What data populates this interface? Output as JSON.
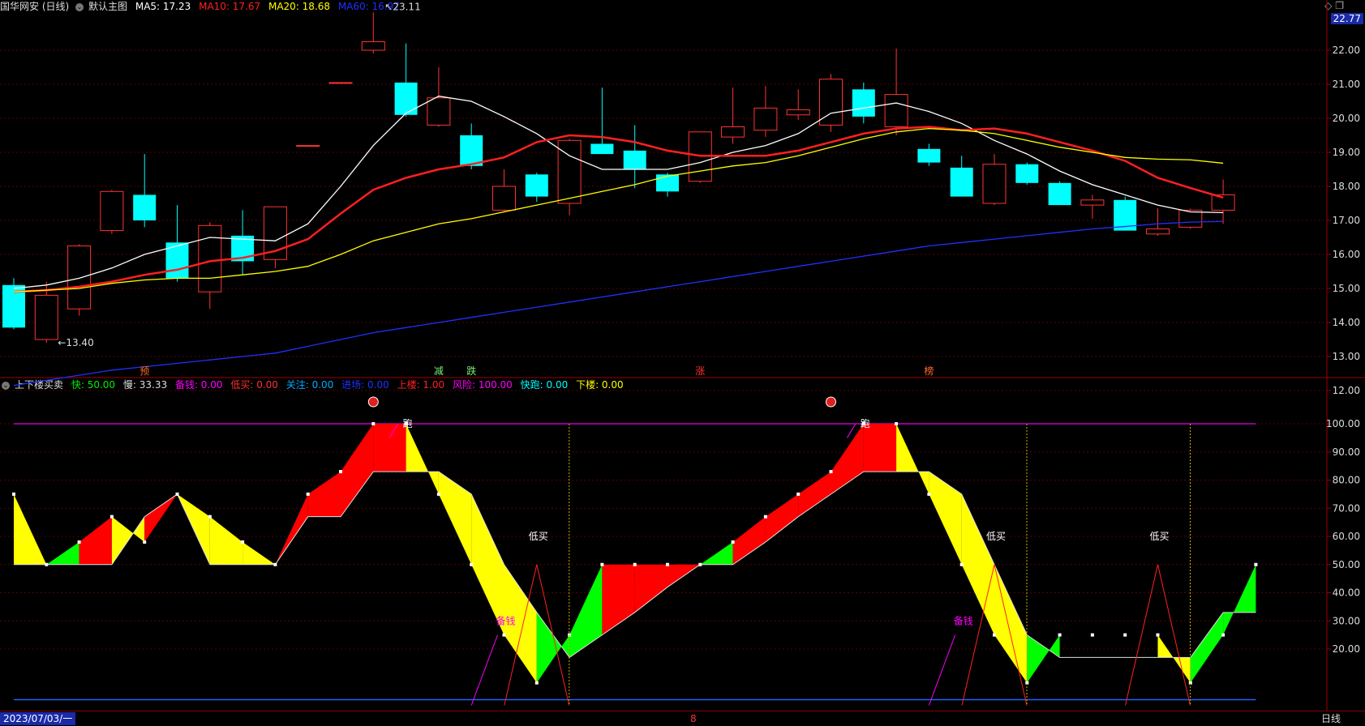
{
  "main": {
    "title": "国华网安 (日线)",
    "template": "默认主图",
    "ma": [
      {
        "label": "MA5: 17.23",
        "color": "#ffffff"
      },
      {
        "label": "MA10: 17.67",
        "color": "#ff2020"
      },
      {
        "label": "MA20: 18.68",
        "color": "#ffff00"
      },
      {
        "label": "MA60: 16.97",
        "color": "#2030ff"
      }
    ],
    "corner_value": "22.77",
    "high_label": "23.11",
    "low_label": "13.40",
    "signals": [
      {
        "text": "预",
        "index": 4,
        "color": "#ff6a2a"
      },
      {
        "text": "减",
        "index": 13,
        "color": "#77ee77"
      },
      {
        "text": "跌",
        "index": 14,
        "color": "#77ee77"
      },
      {
        "text": "涨",
        "index": 21,
        "color": "#ff3030"
      },
      {
        "text": "榜",
        "index": 28,
        "color": "#ff6a2a"
      }
    ]
  },
  "sub": {
    "title": "上下楼买卖",
    "items": [
      {
        "label": "快: 50.00",
        "color": "#00ee00"
      },
      {
        "label": "慢: 33.33",
        "color": "#dddddd"
      },
      {
        "label": "备钱: 0.00",
        "color": "#ff00ff"
      },
      {
        "label": "低买: 0.00",
        "color": "#ff3030"
      },
      {
        "label": "关注: 0.00",
        "color": "#00aaff"
      },
      {
        "label": "进场: 0.00",
        "color": "#2030ff"
      },
      {
        "label": "上楼: 1.00",
        "color": "#ff2020"
      },
      {
        "label": "风险: 100.00",
        "color": "#ff00ff"
      },
      {
        "label": "快跑: 0.00",
        "color": "#00ffff"
      },
      {
        "label": "下楼: 0.00",
        "color": "#ffff00"
      }
    ],
    "text_labels": [
      {
        "text": "跑",
        "index": 12,
        "value": 100,
        "color": "#ffffff"
      },
      {
        "text": "跑",
        "index": 26,
        "value": 100,
        "color": "#ffffff"
      },
      {
        "text": "低买",
        "index": 16,
        "value": 60,
        "color": "#ffffff"
      },
      {
        "text": "低买",
        "index": 30,
        "value": 60,
        "color": "#ffffff"
      },
      {
        "text": "低买",
        "index": 35,
        "value": 60,
        "color": "#ffffff"
      },
      {
        "text": "备钱",
        "index": 15,
        "value": 30,
        "color": "#ff00ff"
      },
      {
        "text": "备钱",
        "index": 29,
        "value": 30,
        "color": "#ff00ff"
      }
    ]
  },
  "bottom": {
    "date": "2023/07/03/一",
    "period": "日线",
    "marker": "8"
  },
  "chart_data": [
    {
      "type": "candlestick",
      "title": "国华网安 (日线)",
      "ylim": [
        11.8,
        23.3
      ],
      "yticks": [
        "12.00",
        "13.00",
        "14.00",
        "15.00",
        "16.00",
        "17.00",
        "18.00",
        "19.00",
        "20.00",
        "21.00",
        "22.00"
      ],
      "candles": [
        {
          "o": 15.1,
          "h": 15.3,
          "l": 13.8,
          "c": 13.85
        },
        {
          "o": 13.5,
          "h": 15.2,
          "l": 13.4,
          "c": 14.8
        },
        {
          "o": 14.4,
          "h": 16.3,
          "l": 14.2,
          "c": 16.25
        },
        {
          "o": 16.7,
          "h": 17.9,
          "l": 16.6,
          "c": 17.85
        },
        {
          "o": 17.75,
          "h": 18.95,
          "l": 16.8,
          "c": 17.0
        },
        {
          "o": 16.35,
          "h": 17.45,
          "l": 15.2,
          "c": 15.3
        },
        {
          "o": 14.9,
          "h": 16.95,
          "l": 14.4,
          "c": 16.85
        },
        {
          "o": 16.55,
          "h": 17.3,
          "l": 15.4,
          "c": 15.8
        },
        {
          "o": 15.85,
          "h": 17.4,
          "l": 15.6,
          "c": 17.4
        },
        {
          "o": 19.2,
          "h": 19.2,
          "l": 19.2,
          "c": 19.2
        },
        {
          "o": 21.05,
          "h": 21.05,
          "l": 21.05,
          "c": 21.05
        },
        {
          "o": 22.0,
          "h": 23.11,
          "l": 21.9,
          "c": 22.25
        },
        {
          "o": 21.05,
          "h": 22.2,
          "l": 20.05,
          "c": 20.1
        },
        {
          "o": 19.8,
          "h": 21.5,
          "l": 19.75,
          "c": 20.6
        },
        {
          "o": 19.5,
          "h": 19.85,
          "l": 18.5,
          "c": 18.6
        },
        {
          "o": 17.3,
          "h": 18.5,
          "l": 17.25,
          "c": 18.0
        },
        {
          "o": 18.35,
          "h": 18.4,
          "l": 17.55,
          "c": 17.7
        },
        {
          "o": 17.5,
          "h": 19.4,
          "l": 17.15,
          "c": 19.35
        },
        {
          "o": 19.25,
          "h": 20.9,
          "l": 19.0,
          "c": 18.95
        },
        {
          "o": 19.05,
          "h": 19.8,
          "l": 17.95,
          "c": 18.5
        },
        {
          "o": 18.35,
          "h": 18.4,
          "l": 17.7,
          "c": 17.85
        },
        {
          "o": 18.15,
          "h": 19.6,
          "l": 18.1,
          "c": 19.6
        },
        {
          "o": 19.45,
          "h": 20.9,
          "l": 19.25,
          "c": 19.75
        },
        {
          "o": 19.65,
          "h": 20.95,
          "l": 19.45,
          "c": 20.3
        },
        {
          "o": 20.1,
          "h": 20.85,
          "l": 19.95,
          "c": 20.25
        },
        {
          "o": 19.8,
          "h": 21.3,
          "l": 19.6,
          "c": 21.15
        },
        {
          "o": 20.85,
          "h": 21.05,
          "l": 19.85,
          "c": 20.05
        },
        {
          "o": 19.75,
          "h": 22.05,
          "l": 19.5,
          "c": 20.7
        },
        {
          "o": 19.1,
          "h": 19.25,
          "l": 18.6,
          "c": 18.7
        },
        {
          "o": 18.55,
          "h": 18.9,
          "l": 17.7,
          "c": 17.7
        },
        {
          "o": 17.5,
          "h": 18.95,
          "l": 17.45,
          "c": 18.65
        },
        {
          "o": 18.65,
          "h": 18.7,
          "l": 18.05,
          "c": 18.1
        },
        {
          "o": 18.1,
          "h": 18.15,
          "l": 17.45,
          "c": 17.45
        },
        {
          "o": 17.45,
          "h": 17.75,
          "l": 17.05,
          "c": 17.6
        },
        {
          "o": 17.6,
          "h": 17.7,
          "l": 16.7,
          "c": 16.7
        },
        {
          "o": 16.6,
          "h": 17.35,
          "l": 16.55,
          "c": 16.75
        },
        {
          "o": 16.8,
          "h": 17.35,
          "l": 16.75,
          "c": 17.3
        },
        {
          "o": 17.3,
          "h": 18.2,
          "l": 16.9,
          "c": 17.75
        }
      ],
      "series": [
        {
          "name": "MA5",
          "color": "#ffffff",
          "values": [
            15.0,
            15.1,
            15.3,
            15.6,
            16.0,
            16.25,
            16.5,
            16.45,
            16.4,
            16.9,
            18.0,
            19.2,
            20.15,
            20.65,
            20.5,
            20.05,
            19.55,
            18.9,
            18.5,
            18.5,
            18.5,
            18.7,
            19.0,
            19.2,
            19.55,
            20.15,
            20.3,
            20.45,
            20.2,
            19.85,
            19.35,
            18.95,
            18.45,
            18.05,
            17.75,
            17.45,
            17.25,
            17.23
          ]
        },
        {
          "name": "MA10",
          "color": "#ff2020",
          "values": [
            14.9,
            14.95,
            15.05,
            15.2,
            15.4,
            15.55,
            15.8,
            15.9,
            16.1,
            16.45,
            17.2,
            17.9,
            18.25,
            18.5,
            18.65,
            18.85,
            19.3,
            19.5,
            19.45,
            19.3,
            19.05,
            18.9,
            18.9,
            18.9,
            19.05,
            19.3,
            19.55,
            19.7,
            19.75,
            19.65,
            19.7,
            19.55,
            19.3,
            19.05,
            18.75,
            18.25,
            17.95,
            17.67
          ]
        },
        {
          "name": "MA20",
          "color": "#ffff00",
          "values": [
            14.9,
            14.95,
            15.0,
            15.15,
            15.25,
            15.3,
            15.3,
            15.4,
            15.5,
            15.65,
            16.0,
            16.4,
            16.65,
            16.9,
            17.05,
            17.25,
            17.45,
            17.65,
            17.85,
            18.05,
            18.3,
            18.45,
            18.6,
            18.7,
            18.9,
            19.15,
            19.4,
            19.6,
            19.7,
            19.65,
            19.55,
            19.35,
            19.15,
            19.0,
            18.85,
            18.8,
            18.78,
            18.68
          ]
        },
        {
          "name": "MA60",
          "color": "#2030ff",
          "values": [
            12.15,
            12.3,
            12.45,
            12.6,
            12.7,
            12.8,
            12.9,
            13.0,
            13.1,
            13.3,
            13.5,
            13.7,
            13.85,
            14.0,
            14.15,
            14.3,
            14.45,
            14.6,
            14.75,
            14.9,
            15.05,
            15.2,
            15.35,
            15.5,
            15.65,
            15.8,
            15.95,
            16.1,
            16.25,
            16.35,
            16.45,
            16.55,
            16.65,
            16.75,
            16.82,
            16.9,
            16.95,
            16.97
          ]
        }
      ]
    },
    {
      "type": "area",
      "title": "上下楼买卖",
      "ylim": [
        0,
        112
      ],
      "yticks": [
        "20.00",
        "30.00",
        "40.00",
        "50.00",
        "60.00",
        "70.00",
        "80.00",
        "90.00",
        "100.00"
      ],
      "series": [
        {
          "name": "快",
          "color": "#00ee00",
          "values": [
            75,
            50,
            58,
            67,
            58,
            75,
            67,
            58,
            50,
            75,
            83,
            100,
            100,
            75,
            50,
            25,
            8,
            25,
            50,
            50,
            50,
            50,
            58,
            67,
            75,
            83,
            100,
            100,
            75,
            50,
            25,
            8,
            25,
            25,
            25,
            25,
            8,
            25,
            50
          ]
        },
        {
          "name": "慢",
          "color": "#dddddd",
          "values": [
            50,
            50,
            50,
            50,
            67,
            75,
            50,
            50,
            50,
            67,
            67,
            83,
            83,
            83,
            75,
            50,
            33,
            17,
            25,
            33,
            42,
            50,
            50,
            58,
            67,
            75,
            83,
            83,
            83,
            75,
            50,
            25,
            17,
            17,
            17,
            17,
            17,
            33,
            33
          ]
        }
      ],
      "red_spikes": [
        16,
        30,
        35
      ]
    }
  ]
}
